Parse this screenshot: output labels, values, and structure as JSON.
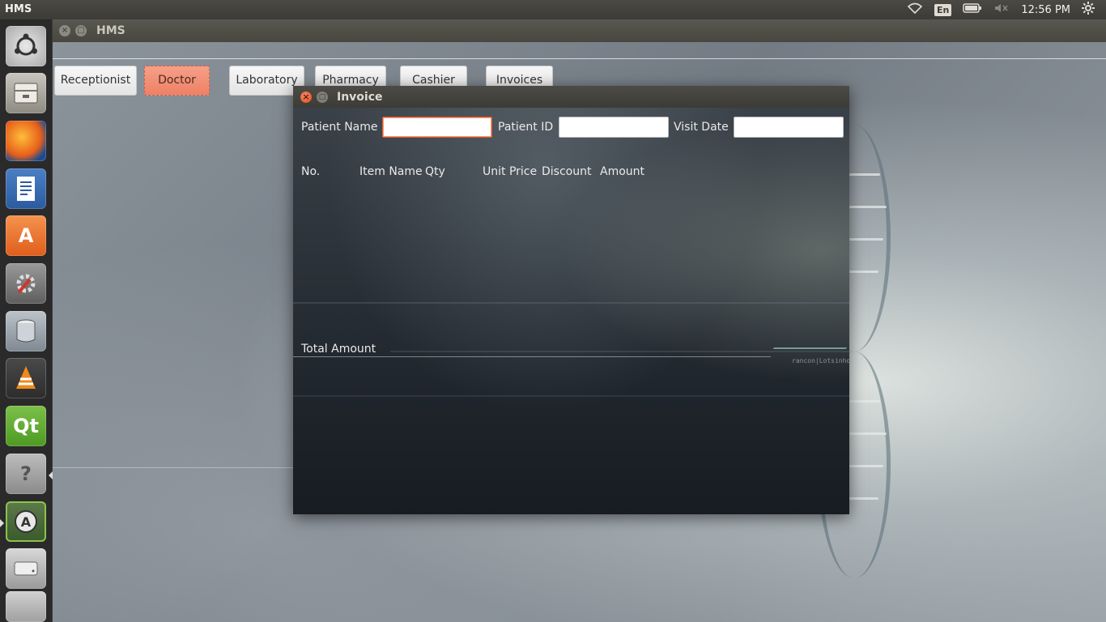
{
  "top_panel": {
    "app_name": "HMS",
    "lang": "En",
    "clock": "12:56 PM"
  },
  "main_window": {
    "title": "HMS",
    "nav_buttons": [
      {
        "label": "Receptionist",
        "active": false
      },
      {
        "label": "Doctor",
        "active": true
      },
      {
        "label": "Laboratory",
        "active": false
      },
      {
        "label": "Pharmacy",
        "active": false
      },
      {
        "label": "Cashier",
        "active": false
      },
      {
        "label": "Invoices",
        "active": false
      }
    ]
  },
  "invoice_dialog": {
    "title": "Invoice",
    "fields": {
      "patient_name_label": "Patient Name",
      "patient_name_value": "",
      "patient_id_label": "Patient ID",
      "patient_id_value": "",
      "visit_date_label": "Visit Date",
      "visit_date_value": ""
    },
    "table_headers": [
      "No.",
      "Item Name",
      "Qty",
      "Unit Price",
      "Discount",
      "Amount"
    ],
    "total_label": "Total Amount",
    "watermark": "rancon|Lotsinho"
  },
  "colors": {
    "accent": "#e05a2b",
    "active_button": "#ef8065",
    "panel": "#3c3b37"
  },
  "launcher_icons": [
    "ubuntu-dash-icon",
    "files-icon",
    "firefox-icon",
    "writer-icon",
    "software-center-icon",
    "system-settings-icon",
    "database-icon",
    "vlc-icon",
    "qt-creator-icon",
    "help-icon",
    "software-updater-icon",
    "disk-icon",
    "trash-icon"
  ]
}
